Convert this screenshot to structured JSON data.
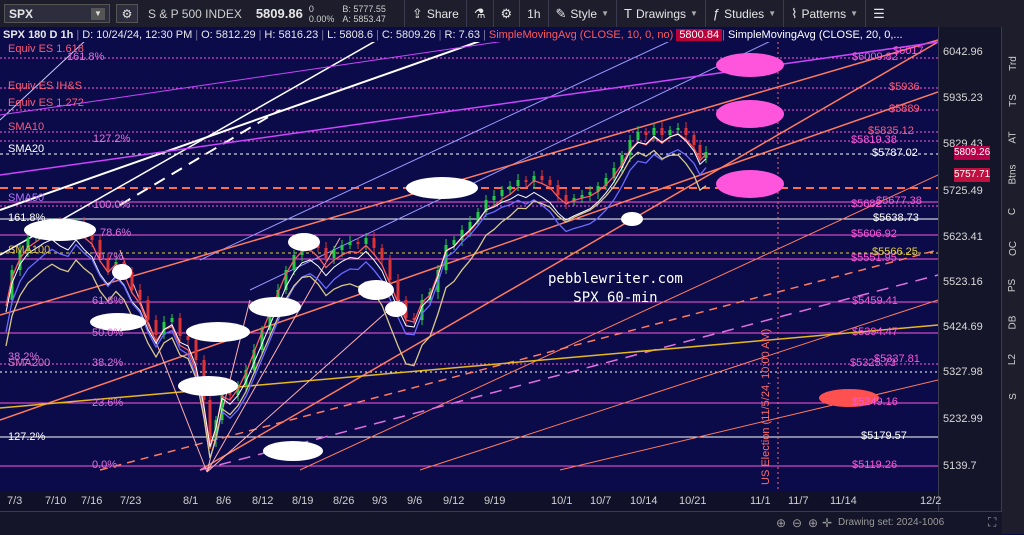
{
  "toolbar": {
    "symbol": "SPX",
    "name": "S & P 500 INDEX",
    "price": "5809.86",
    "change": "0",
    "change_pct": "0.00%",
    "bid": "B: 5777.55",
    "ask": "A: 5853.47",
    "share_label": "Share",
    "timeframe_label": "1h",
    "style_label": "Style",
    "drawings_label": "Drawings",
    "studies_label": "Studies",
    "patterns_label": "Patterns"
  },
  "info_bar": {
    "title": "SPX 180 D 1h",
    "date": "D: 10/24/24, 12:30 PM",
    "open": "O: 5812.29",
    "high": "H: 5816.23",
    "low": "L: 5808.6",
    "close": "C: 5809.26",
    "range": "R: 7.63",
    "sma10_label": "SimpleMovingAvg (CLOSE, 10, 0, no)",
    "sma10_value": "5800.84",
    "sma20_label": "SimpleMovingAvg (CLOSE, 20, 0,..."
  },
  "sidebar": [
    "Trd",
    "TS",
    "AT",
    "Btns",
    "C",
    "OC",
    "PS",
    "DB",
    "L2",
    "S"
  ],
  "y_axis": {
    "ticks": [
      "6042.96",
      "5935.23",
      "5829.43",
      "5725.49",
      "5623.41",
      "5523.16",
      "5424.69",
      "5327.98",
      "5232.99",
      "5139.7"
    ],
    "last_price": "5809.26",
    "sma_price": "5757.71"
  },
  "x_axis": {
    "ticks": [
      "7/3",
      "7/10",
      "7/16",
      "7/23",
      "8/1",
      "8/6",
      "8/12",
      "8/19",
      "8/26",
      "9/3",
      "9/6",
      "9/12",
      "9/19",
      "10/1",
      "10/7",
      "10/14",
      "10/21",
      "11/1",
      "11/7",
      "11/14",
      "12/2"
    ]
  },
  "status": {
    "drawing_set": "Drawing set: 2024-1006"
  },
  "left_labels": [
    {
      "text": "Equiv ES 1.618",
      "color": "#ff5a7a"
    },
    {
      "text": "Equiv ES IH&S",
      "color": "#ff5a7a"
    },
    {
      "text": "Equiv ES 1.272",
      "color": "#ff5a7a"
    },
    {
      "text": "SMA10",
      "color": "#ff5a7a"
    },
    {
      "text": "SMA20",
      "color": "#ffffff"
    },
    {
      "text": "SMA50",
      "color": "#b070ff"
    },
    {
      "text": "SMA100",
      "color": "#e0c040"
    },
    {
      "text": "SMA200",
      "color": "#e070c0"
    }
  ],
  "fib_labels": [
    "161.8%",
    "127.2%",
    "100.0%",
    "161.8%",
    "78.6%",
    "70.7%",
    "61.8%",
    "50.0%",
    "38.2%",
    "23.6%",
    "127.2%",
    "0.0%",
    "38.2%"
  ],
  "right_levels": [
    "$6009.82",
    "$6017",
    "$5936",
    "$5889",
    "$5835.12",
    "$5819.38",
    "$5787.02",
    "$5677.38",
    "$5638.73",
    "$5606.92",
    "$5566.25",
    "$5551.95",
    "$5459.41",
    "$5394.47",
    "$5337.81",
    "$5325.73",
    "$5249.16",
    "$5179.57",
    "$5119.26",
    "$5682"
  ],
  "watermark": [
    "pebblewriter.com",
    "SPX 60-min"
  ],
  "annotation": "US Election (11/5/24, 10:00 AM)",
  "colors": {
    "background": "#0b0b4a",
    "toolbar": "#1d1d2b",
    "accent_pink": "#ff55dd",
    "up": "#22cc44",
    "down": "#dd3333",
    "sma200": "#e6b81e"
  }
}
